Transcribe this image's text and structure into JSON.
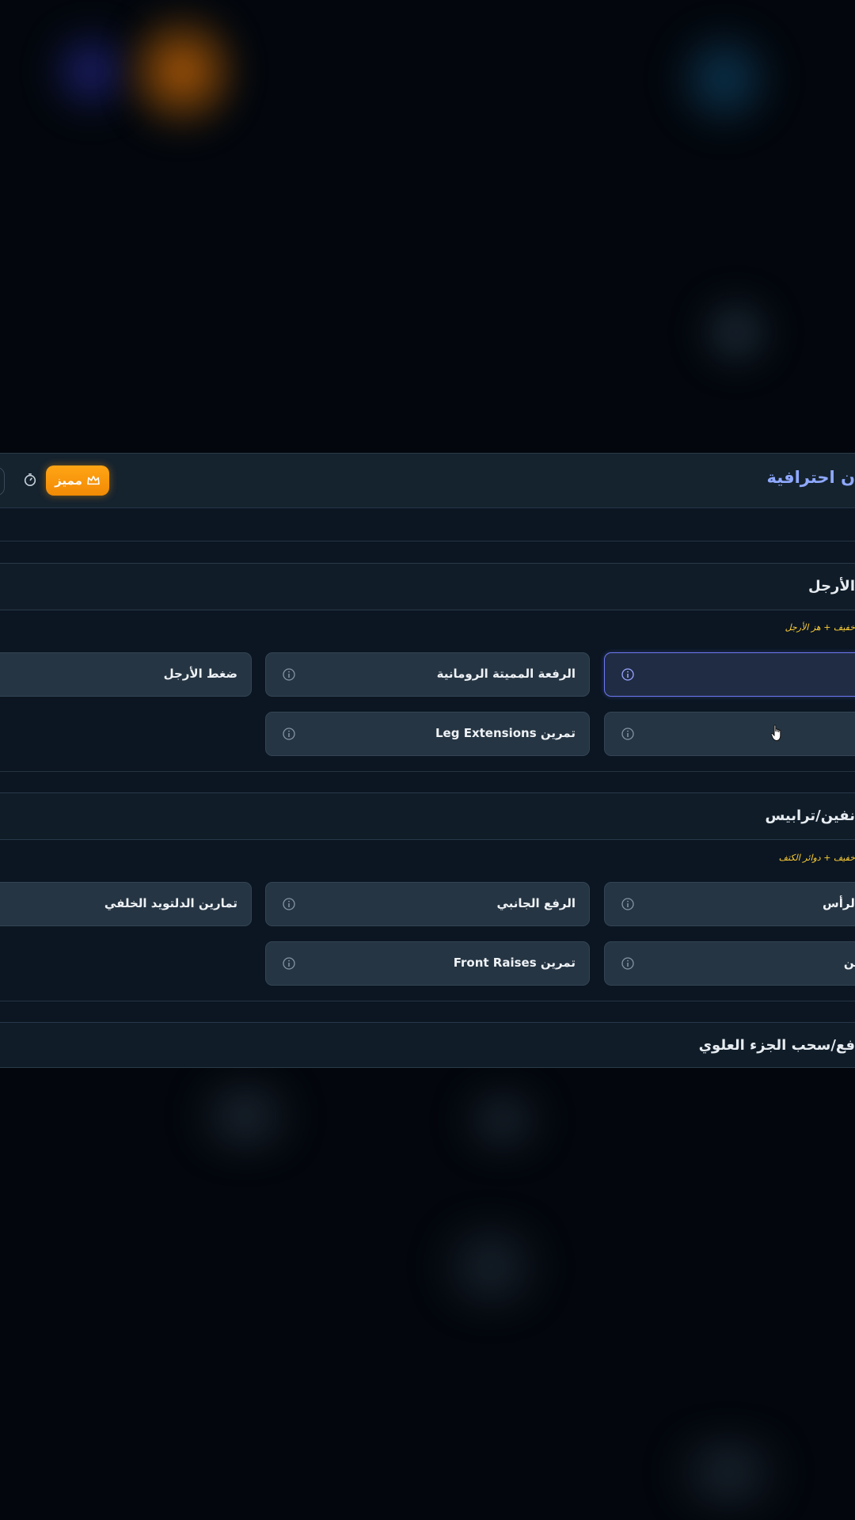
{
  "header": {
    "title": "ن احترافية",
    "premium_label": "مميز",
    "icons": {
      "premium": "crown-icon",
      "timer": "timer-icon"
    }
  },
  "top_partial_cards": [
    {
      "label": ""
    },
    {
      "label": ""
    }
  ],
  "sections": [
    {
      "title": "الأرجل",
      "hint": "خفيف + هز الأرجل",
      "cards": [
        {
          "label": "",
          "selected": true
        },
        {
          "label": "الرفعة المميتة الرومانية",
          "selected": false
        },
        {
          "label": "ضغط الأرجل",
          "selected": false
        },
        {
          "label": "",
          "selected": false
        },
        {
          "label": "تمرين Leg Extensions",
          "selected": false
        }
      ]
    },
    {
      "title": "نفين/ترابيس",
      "hint": "خفيف + دوائر الكتف",
      "cards": [
        {
          "label": "الرأس",
          "selected": false
        },
        {
          "label": "الرفع الجانبي",
          "selected": false
        },
        {
          "label": "تمارين الدلتويد الخلفي",
          "selected": false
        },
        {
          "label": "ين",
          "selected": false
        },
        {
          "label": "تمرين Front Raises",
          "selected": false
        }
      ]
    },
    {
      "title": "فع/سحب الجزء العلوي"
    }
  ],
  "colors": {
    "accent": "#8fa9ff",
    "premium": "#ffa514",
    "hint": "#ffcf36",
    "selected_border": "#6d78f0"
  }
}
